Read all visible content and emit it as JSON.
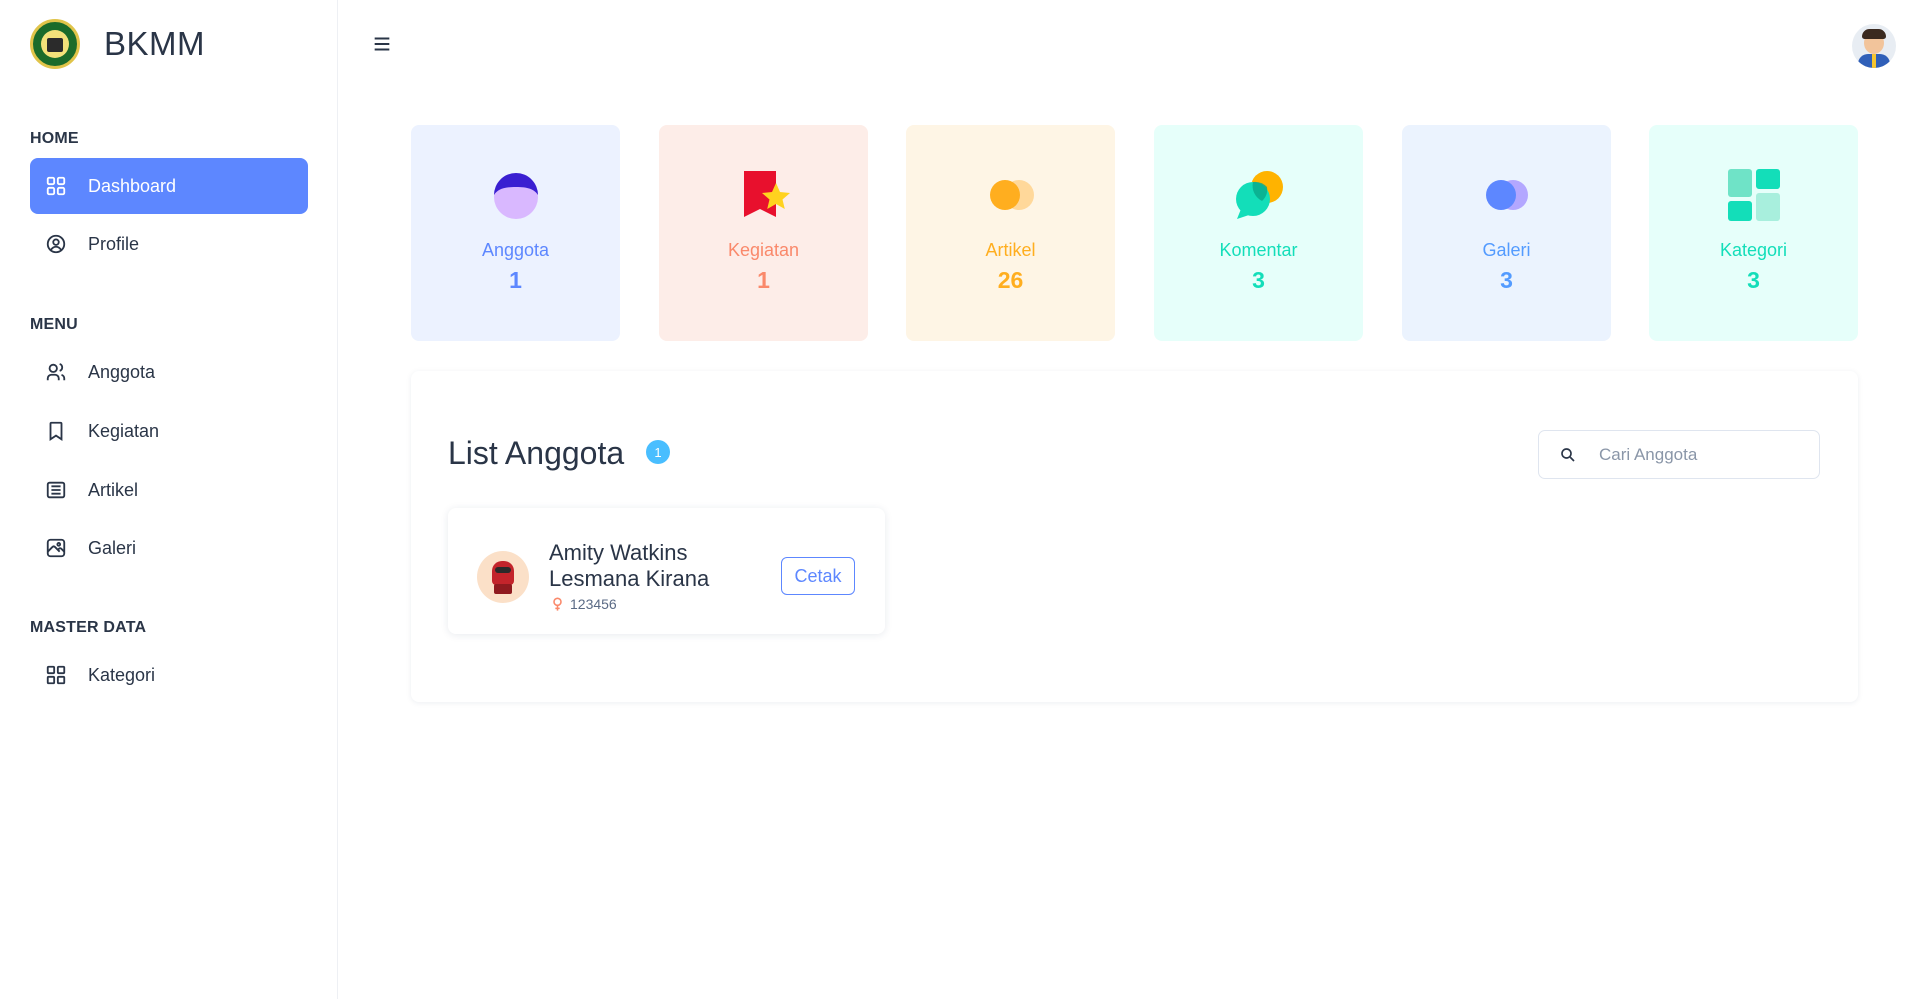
{
  "app": {
    "name": "BKMM"
  },
  "sidebar": {
    "sections": [
      {
        "title": "HOME",
        "items": [
          {
            "label": "Dashboard",
            "icon": "dashboard-grid-icon",
            "active": true
          },
          {
            "label": "Profile",
            "icon": "user-circle-icon",
            "active": false
          }
        ]
      },
      {
        "title": "MENU",
        "items": [
          {
            "label": "Anggota",
            "icon": "users-icon",
            "active": false
          },
          {
            "label": "Kegiatan",
            "icon": "bookmark-icon",
            "active": false
          },
          {
            "label": "Artikel",
            "icon": "article-icon",
            "active": false
          },
          {
            "label": "Galeri",
            "icon": "photo-icon",
            "active": false
          }
        ]
      },
      {
        "title": "MASTER DATA",
        "items": [
          {
            "label": "Kategori",
            "icon": "category-grid-icon",
            "active": false
          }
        ]
      }
    ]
  },
  "stats": [
    {
      "label": "Anggota",
      "value": "1",
      "color": "#5d87ff",
      "bg": "#ecf2ff",
      "icon": "user-avatar-icon"
    },
    {
      "label": "Kegiatan",
      "value": "1",
      "color": "#fa896b",
      "bg": "#fdede8",
      "icon": "ribbon-star-icon"
    },
    {
      "label": "Artikel",
      "value": "26",
      "color": "#ffae1f",
      "bg": "#fef5e5",
      "icon": "coins-icon"
    },
    {
      "label": "Komentar",
      "value": "3",
      "color": "#13deb9",
      "bg": "#e6fffa",
      "icon": "chat-bubbles-icon"
    },
    {
      "label": "Galeri",
      "value": "3",
      "color": "#539bff",
      "bg": "#ebf3fe",
      "icon": "circles-icon"
    },
    {
      "label": "Kategori",
      "value": "3",
      "color": "#13deb9",
      "bg": "#e6fffa",
      "icon": "tiles-icon"
    }
  ],
  "list": {
    "title": "List Anggota",
    "count": "1",
    "search_placeholder": "Cari Anggota",
    "members": [
      {
        "name": "Amity Watkins Lesmana Kirana",
        "id": "123456",
        "action": "Cetak"
      }
    ]
  },
  "colors": {
    "primary": "#5d87ff",
    "info": "#49beff",
    "text": "#2a3547"
  }
}
